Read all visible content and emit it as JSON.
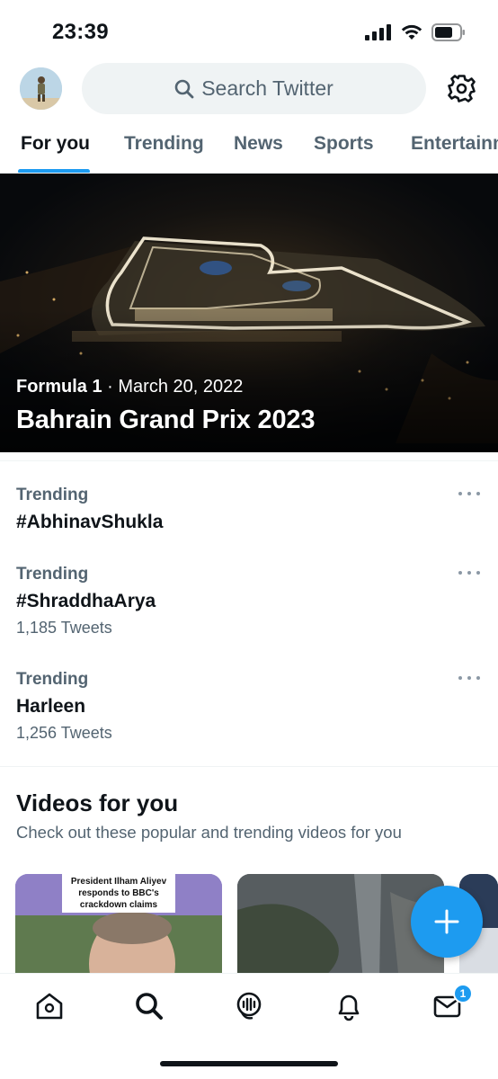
{
  "status_bar": {
    "time": "23:39"
  },
  "header": {
    "search_placeholder": "Search Twitter",
    "icons": {
      "avatar": "profile-avatar",
      "search": "search-icon",
      "settings": "gear-icon"
    }
  },
  "tabs": [
    {
      "label": "For you",
      "active": true
    },
    {
      "label": "Trending",
      "active": false
    },
    {
      "label": "News",
      "active": false
    },
    {
      "label": "Sports",
      "active": false
    },
    {
      "label": "Entertainment",
      "active": false
    }
  ],
  "hero": {
    "category": "Formula 1",
    "separator": "·",
    "date": "March 20, 2022",
    "title": "Bahrain Grand Prix 2023"
  },
  "trends": [
    {
      "context": "Trending",
      "name": "#AbhinavShukla",
      "count": ""
    },
    {
      "context": "Trending",
      "name": "#ShraddhaArya",
      "count": "1,185 Tweets"
    },
    {
      "context": "Trending",
      "name": "Harleen",
      "count": "1,256 Tweets"
    }
  ],
  "videos": {
    "title": "Videos for you",
    "subtitle": "Check out these popular and trending videos for you",
    "items": [
      {
        "caption": "President Ilham Aliyev responds to BBC's crackdown claims"
      },
      {
        "caption": ""
      },
      {
        "caption": ""
      }
    ]
  },
  "bottom_nav": {
    "items": [
      "home-icon",
      "search-icon",
      "spaces-icon",
      "notifications-bell-icon",
      "messages-envelope-icon"
    ],
    "messages_badge": "1"
  },
  "colors": {
    "accent": "#1d9bf0",
    "secondary_text": "#536471",
    "primary_text": "#0f1419",
    "search_bg": "#eff3f4"
  }
}
